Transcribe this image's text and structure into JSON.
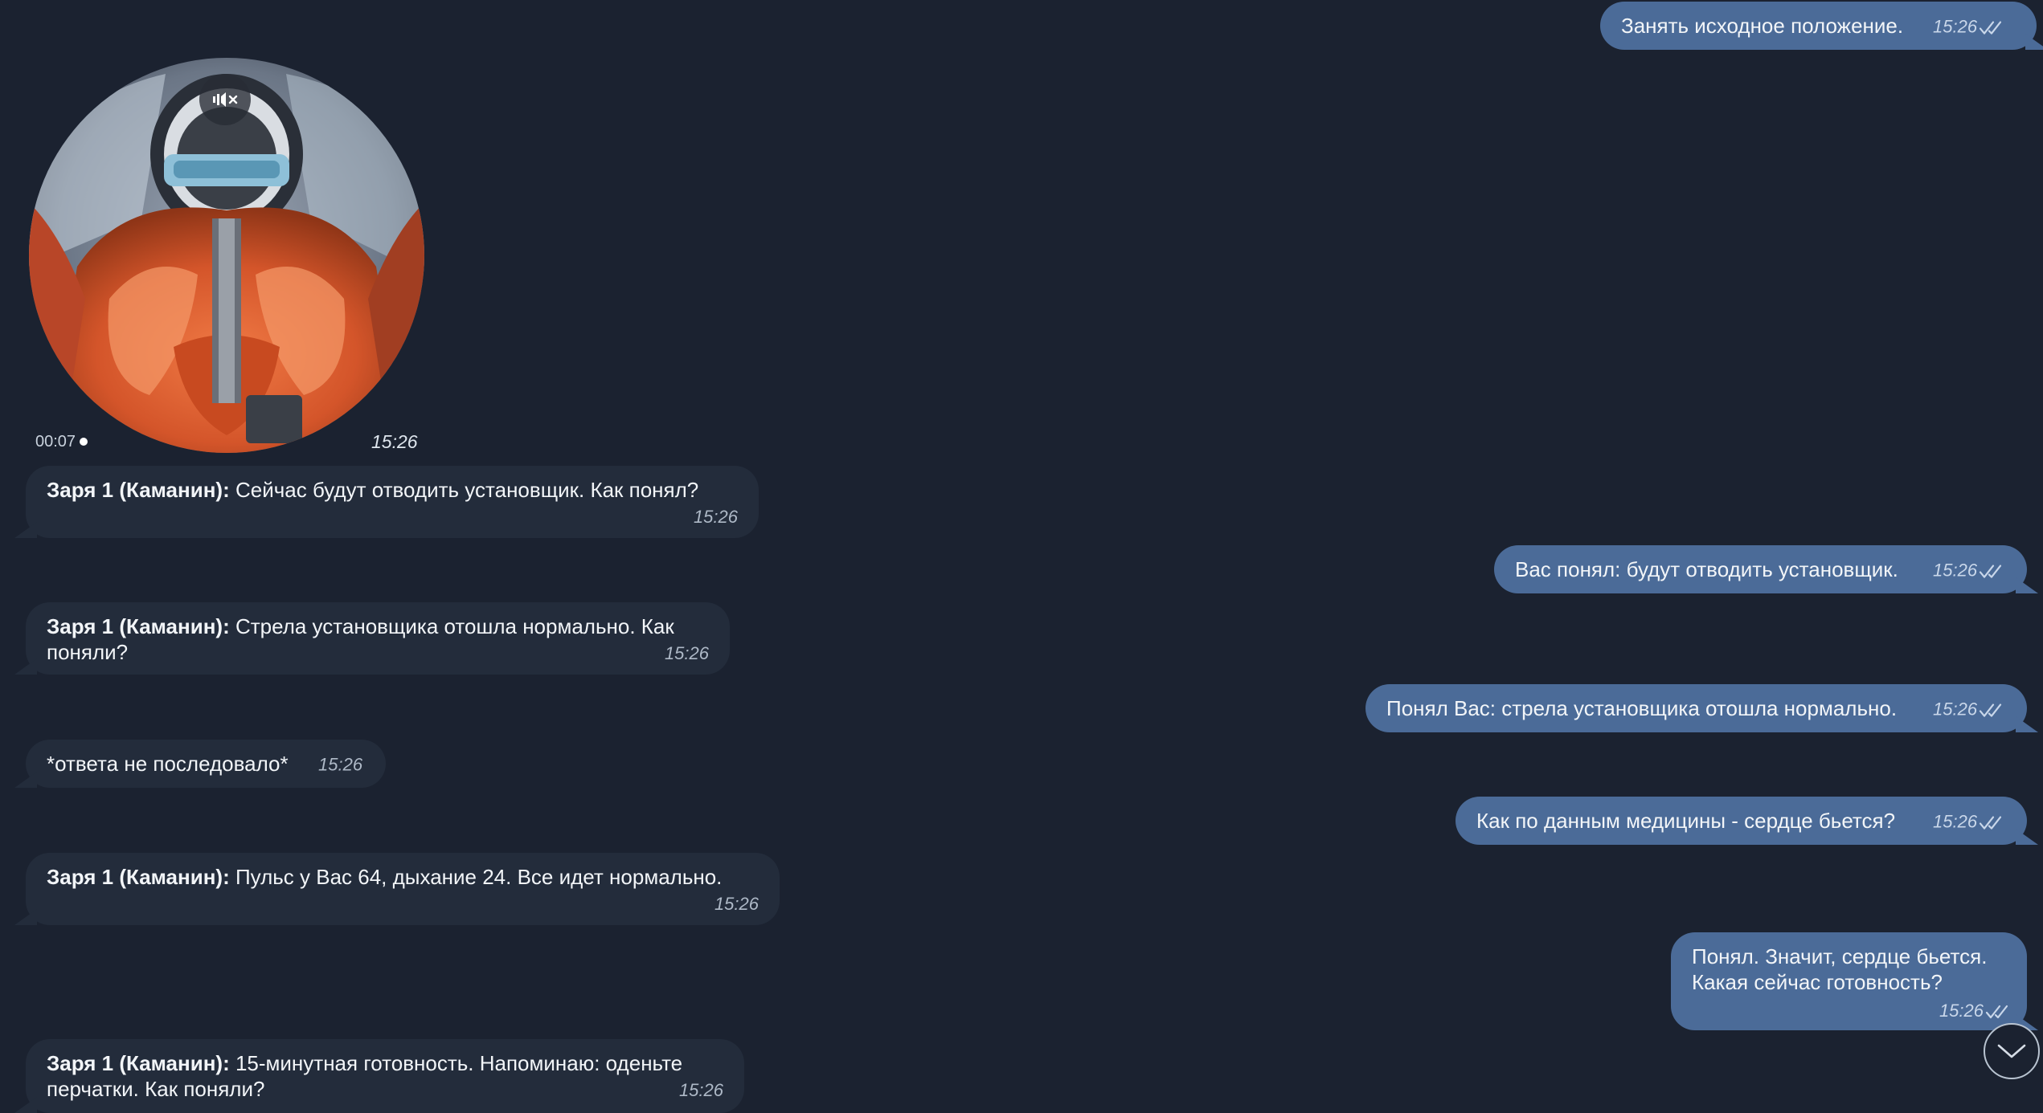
{
  "colors": {
    "background": "#1b2230",
    "incoming_bubble": "#232c3b",
    "outgoing_bubble": "#4b6b98"
  },
  "video_note": {
    "duration": "00:07",
    "time": "15:26",
    "mute_icon": "speaker-muted-icon"
  },
  "messages": [
    {
      "direction": "out",
      "text": "Занять исходное положение.",
      "time": "15:26",
      "status": "read"
    },
    {
      "direction": "in",
      "sender": "Заря 1 (Каманин):",
      "text": " Сейчас будут отводить установщик. Как понял?",
      "time": "15:26"
    },
    {
      "direction": "out",
      "text": "Вас понял: будут отводить установщик.",
      "time": "15:26",
      "status": "read"
    },
    {
      "direction": "in",
      "sender": "Заря 1 (Каманин):",
      "text": " Стрела установщика отошла нормально. Как",
      "text2": "поняли?",
      "time": "15:26"
    },
    {
      "direction": "out",
      "text": "Понял Вас: стрела установщика отошла нормально.",
      "time": "15:26",
      "status": "read"
    },
    {
      "direction": "in",
      "text": "*ответа не последовало*",
      "time": "15:26"
    },
    {
      "direction": "out",
      "text": "Как по данным медицины - сердце бьется?",
      "time": "15:26",
      "status": "read"
    },
    {
      "direction": "in",
      "sender": "Заря 1 (Каманин):",
      "text": " Пульс у Вас 64, дыхание 24. Все идет нормально.",
      "time": "15:26"
    },
    {
      "direction": "out",
      "text": "Понял. Значит, сердце бьется.",
      "text2": "Какая сейчас готовность?",
      "time": "15:26",
      "status": "read"
    },
    {
      "direction": "in",
      "sender": "Заря 1 (Каманин):",
      "text": " 15-минутная готовность. Напоминаю: оденьте",
      "text2": "перчатки. Как поняли?",
      "time": "15:26"
    }
  ],
  "scroll_button_icon": "chevron-down-icon"
}
